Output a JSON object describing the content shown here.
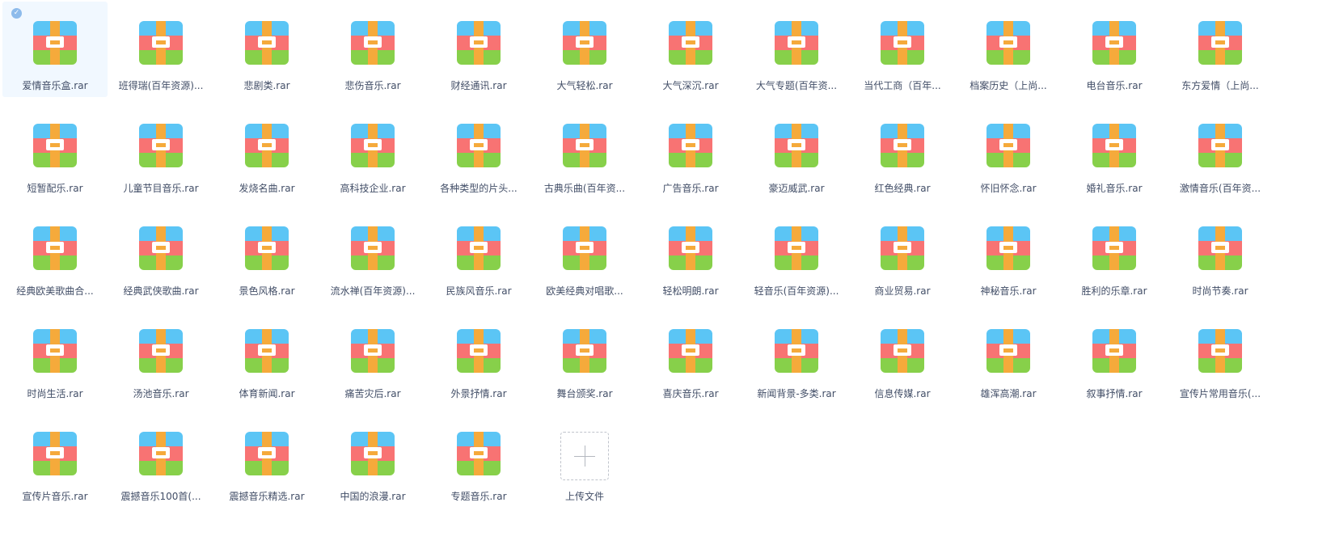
{
  "files": [
    {
      "name": "爱情音乐盒.rar",
      "selected": true
    },
    {
      "name": "班得瑞(百年资源)..."
    },
    {
      "name": "悲剧类.rar"
    },
    {
      "name": "悲伤音乐.rar"
    },
    {
      "name": "财经通讯.rar"
    },
    {
      "name": "大气轻松.rar"
    },
    {
      "name": "大气深沉.rar"
    },
    {
      "name": "大气专题(百年资..."
    },
    {
      "name": "当代工商（百年..."
    },
    {
      "name": "档案历史（上尚..."
    },
    {
      "name": "电台音乐.rar"
    },
    {
      "name": "东方爱情（上尚..."
    },
    {
      "name": "短暂配乐.rar"
    },
    {
      "name": "儿童节目音乐.rar"
    },
    {
      "name": "发烧名曲.rar"
    },
    {
      "name": "高科技企业.rar"
    },
    {
      "name": "各种类型的片头..."
    },
    {
      "name": "古典乐曲(百年资..."
    },
    {
      "name": "广告音乐.rar"
    },
    {
      "name": "豪迈威武.rar"
    },
    {
      "name": "红色经典.rar"
    },
    {
      "name": "怀旧怀念.rar"
    },
    {
      "name": "婚礼音乐.rar"
    },
    {
      "name": "激情音乐(百年资..."
    },
    {
      "name": "经典欧美歌曲合..."
    },
    {
      "name": "经典武侠歌曲.rar"
    },
    {
      "name": "景色风格.rar"
    },
    {
      "name": "流水禅(百年资源)..."
    },
    {
      "name": "民族风音乐.rar"
    },
    {
      "name": "欧美经典对唱歌..."
    },
    {
      "name": "轻松明朗.rar"
    },
    {
      "name": "轻音乐(百年资源)..."
    },
    {
      "name": "商业贸易.rar"
    },
    {
      "name": "神秘音乐.rar"
    },
    {
      "name": "胜利的乐章.rar"
    },
    {
      "name": "时尚节奏.rar"
    },
    {
      "name": "时尚生活.rar"
    },
    {
      "name": "汤池音乐.rar"
    },
    {
      "name": "体育新闻.rar"
    },
    {
      "name": "痛苦灾后.rar"
    },
    {
      "name": "外景抒情.rar"
    },
    {
      "name": "舞台颁奖.rar"
    },
    {
      "name": "喜庆音乐.rar"
    },
    {
      "name": "新闻背景-多类.rar"
    },
    {
      "name": "信息传媒.rar"
    },
    {
      "name": "雄浑高潮.rar"
    },
    {
      "name": "叙事抒情.rar"
    },
    {
      "name": "宣传片常用音乐(..."
    },
    {
      "name": "宣传片音乐.rar"
    },
    {
      "name": "震撼音乐100首(..."
    },
    {
      "name": "震撼音乐精选.rar"
    },
    {
      "name": "中国的浪漫.rar"
    },
    {
      "name": "专题音乐.rar"
    }
  ],
  "upload": {
    "label": "上传文件"
  },
  "icon_name": "archive-icon",
  "check_glyph": "✓",
  "colors": {
    "top": "#5bc5f5",
    "middle": "#f87373",
    "bottom": "#87d04a",
    "strap": "#f5aa3b",
    "clasp": "#ffffff",
    "selected_bg": "#f1f8ff"
  }
}
